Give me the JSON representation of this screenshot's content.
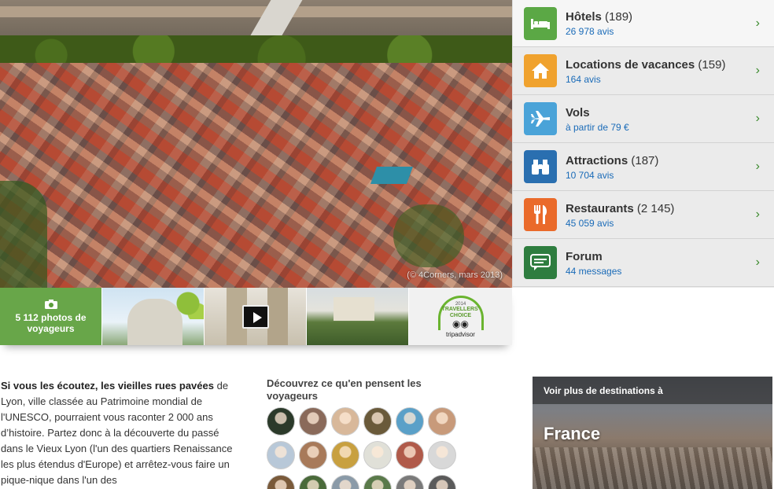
{
  "hero": {
    "credit": "(© 4Corners, mars 2013)"
  },
  "thumbs": {
    "photos_label": "5 112 photos de voyageurs",
    "travellers_choice": {
      "year": "2014",
      "line1": "TRAVELLERS'",
      "line2": "CHOICE",
      "brand": "tripadvisor"
    }
  },
  "categories": [
    {
      "title": "Hôtels",
      "count": "(189)",
      "sub": "26 978 avis",
      "icon": "bed-icon",
      "color": "#5ba845"
    },
    {
      "title": "Locations de vacances",
      "count": "(159)",
      "sub": "164 avis",
      "icon": "house-icon",
      "color": "#f0a22e"
    },
    {
      "title": "Vols",
      "count": "",
      "sub": "à partir de 79 €",
      "icon": "plane-icon",
      "color": "#4aa3d8"
    },
    {
      "title": "Attractions",
      "count": "(187)",
      "sub": "10 704 avis",
      "icon": "binoculars-icon",
      "color": "#2a6fb0"
    },
    {
      "title": "Restaurants",
      "count": "(2 145)",
      "sub": "45 059 avis",
      "icon": "fork-knife-icon",
      "color": "#ea6a2a"
    },
    {
      "title": "Forum",
      "count": "",
      "sub": "44 messages",
      "icon": "chat-icon",
      "color": "#2e7d3f"
    }
  ],
  "intro": {
    "lead": "Si vous les écoutez, les vieilles rues pavées",
    "body": " de Lyon, ville classée au Patrimoine mondial de l'UNESCO, pourraient vous raconter 2 000 ans d’histoire. Partez donc à la découverte du passé dans le Vieux Lyon (l'un des quartiers Renaissance les plus étendus d'Europe) et arrêtez-vous faire un pique-nique dans l'un des"
  },
  "reviews": {
    "title": "Découvrez ce qu'en pensent les voyageurs",
    "avatar_colors": [
      "#2b3a2a",
      "#8a6a5a",
      "#d8b89a",
      "#6a5a3a",
      "#5aa0c8",
      "#c89a7a",
      "#b8c8d8",
      "#a87a5a",
      "#c8a040",
      "#e0e0d8",
      "#b05a4a",
      "#d8d8d8",
      "#7a5a3a",
      "#4a6a3a",
      "#8a9aa8",
      "#5a7a4a",
      "#7a7a7a",
      "#5a5a5a"
    ]
  },
  "destination": {
    "sub": "Voir plus de destinations à",
    "title": "France"
  }
}
